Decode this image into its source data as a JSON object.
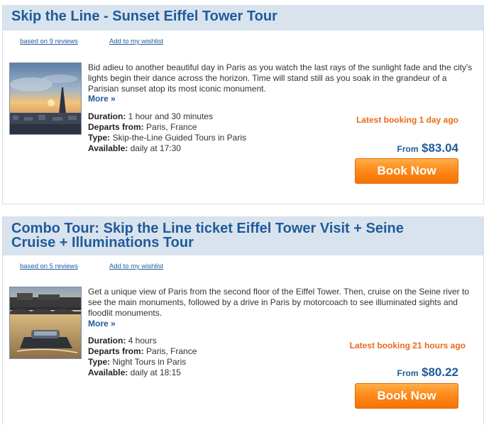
{
  "tours": [
    {
      "title": "Skip the Line - Sunset Eiffel Tower Tour",
      "reviews_link": "based on 9 reviews",
      "wishlist_link": "Add to my wishlist",
      "description": "Bid adieu to another beautiful day in Paris as you watch the last rays of the sunlight fade and the city's lights begin their dance across the horizon. Time will stand still as you soak in the grandeur of a Parisian sunset atop its most iconic monument.",
      "more": "More »",
      "duration_label": "Duration:",
      "duration": "1 hour and 30 minutes",
      "departs_label": "Departs from:",
      "departs": "Paris, France",
      "type_label": "Type:",
      "type": "Skip-the-Line Guided Tours in Paris",
      "available_label": "Available:",
      "available": "daily at 17:30",
      "latest_booking": "Latest booking 1 day ago",
      "from_label": "From",
      "price": "$83.04",
      "book_label": "Book Now"
    },
    {
      "title_line1": "Combo Tour: Skip the Line ticket Eiffel Tower Visit + Seine",
      "title_line2": "Cruise + Illuminations Tour",
      "reviews_link": "based on 5 reviews",
      "wishlist_link": "Add to my wishlist",
      "description": "Get a unique view of Paris from the second floor of the Eiffel Tower. Then, cruise on the Seine river to see the main monuments, followed by a drive in Paris by motorcoach to see illuminated sights and floodlit monuments.",
      "more": "More »",
      "duration_label": "Duration:",
      "duration": "4 hours",
      "departs_label": "Departs from:",
      "departs": "Paris, France",
      "type_label": "Type:",
      "type": "Night Tours in Paris",
      "available_label": "Available:",
      "available": "daily at 18:15",
      "latest_booking": "Latest booking 21 hours ago",
      "from_label": "From",
      "price": "$80.22",
      "book_label": "Book Now"
    }
  ],
  "colors": {
    "title_blue": "#1f5b99",
    "title_bar_bg": "#d9e3ee",
    "latest_orange": "#e86a1a",
    "button_orange": "#ff8a1a"
  }
}
